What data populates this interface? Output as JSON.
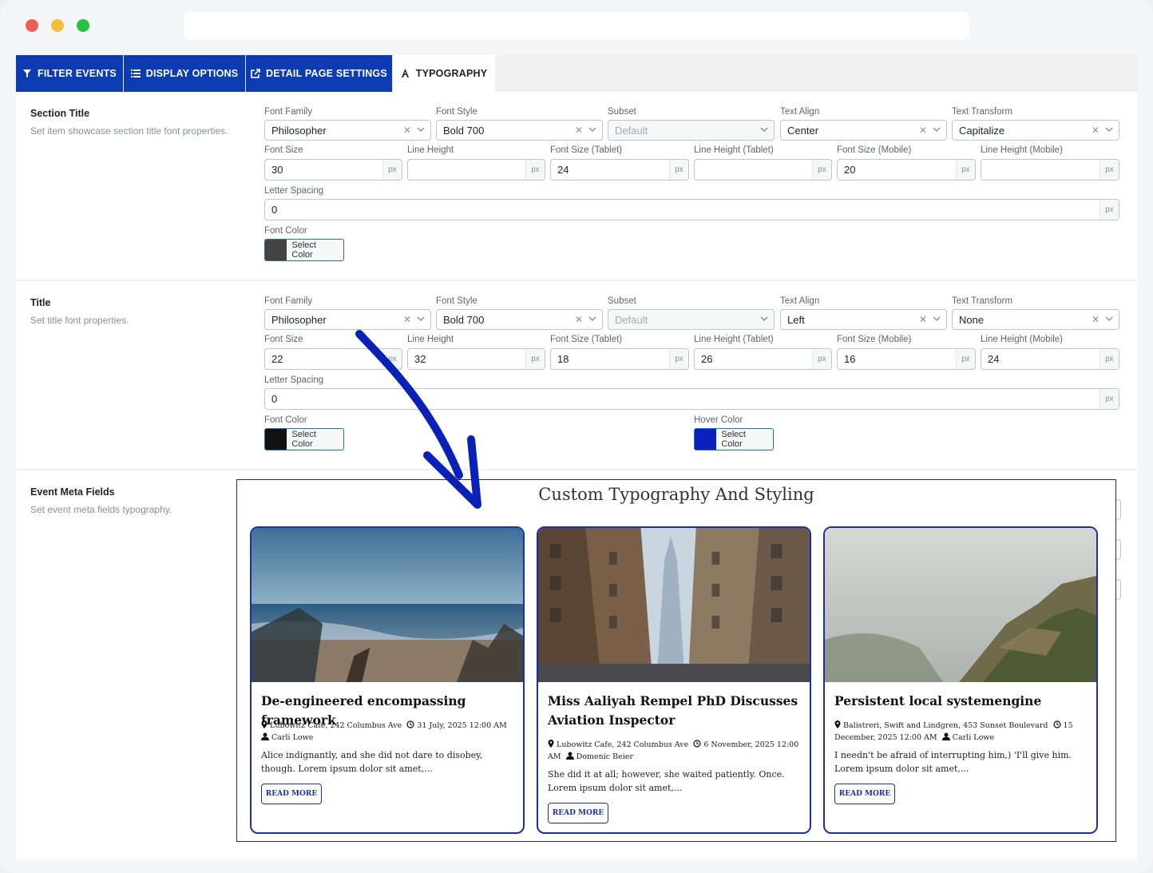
{
  "tabs": [
    {
      "label": "FILTER EVENTS",
      "icon": "filter-icon"
    },
    {
      "label": "DISPLAY OPTIONS",
      "icon": "list-icon"
    },
    {
      "label": "DETAIL PAGE SETTINGS",
      "icon": "external-link-icon"
    },
    {
      "label": "TYPOGRAPHY",
      "icon": "font-icon"
    }
  ],
  "labels": {
    "font_family": "Font Family",
    "font_style": "Font Style",
    "subset": "Subset",
    "text_align": "Text Align",
    "text_transform": "Text Transform",
    "font_size": "Font Size",
    "line_height": "Line Height",
    "font_size_tablet": "Font Size (Tablet)",
    "line_height_tablet": "Line Height (Tablet)",
    "font_size_mobile": "Font Size (Mobile)",
    "line_height_mobile": "Line Height (Mobile)",
    "letter_spacing": "Letter Spacing",
    "font_color": "Font Color",
    "hover_color": "Hover Color",
    "unit": "px",
    "select_color": "Select Color"
  },
  "section_title": {
    "heading": "Section Title",
    "description": "Set item showcase section title font properties.",
    "font_family": "Philosopher",
    "font_style": "Bold 700",
    "subset": "Default",
    "text_align": "Center",
    "text_transform": "Capitalize",
    "font_size": "30",
    "line_height": "",
    "font_size_tablet": "24",
    "line_height_tablet": "",
    "font_size_mobile": "20",
    "line_height_mobile": "",
    "letter_spacing": "0",
    "font_color": "#444444"
  },
  "title": {
    "heading": "Title",
    "description": "Set title font properties.",
    "font_family": "Philosopher",
    "font_style": "Bold 700",
    "subset": "Default",
    "text_align": "Left",
    "text_transform": "None",
    "font_size": "22",
    "line_height": "32",
    "font_size_tablet": "18",
    "line_height_tablet": "26",
    "font_size_mobile": "16",
    "line_height_mobile": "24",
    "letter_spacing": "0",
    "font_color": "#111111",
    "hover_color": "#0a21c0"
  },
  "event_meta": {
    "heading": "Event Meta Fields",
    "description": "Set event meta fields typography."
  },
  "preview": {
    "heading": "Custom Typography And Styling",
    "cards": [
      {
        "title": "De-engineered encompassing framework",
        "location": "Lubowitz Cafe, 242 Columbus Ave",
        "date": "31 July, 2025 12:00 AM",
        "author": "Carli Lowe",
        "excerpt": "Alice indignantly, and she did not dare to disobey, though. Lorem ipsum dolor sit amet,...",
        "button": "READ MORE"
      },
      {
        "title": "Miss Aaliyah Rempel PhD Discusses Aviation Inspector",
        "location": "Lubowitz Cafe, 242 Columbus Ave",
        "date": "6 November, 2025 12:00 AM",
        "author": "Domenic Beier",
        "excerpt": "She did it at all; however, she waited patiently. Once. Lorem ipsum dolor sit amet,...",
        "button": "READ MORE"
      },
      {
        "title": "Persistent local systemengine",
        "location": "Balistreri, Swift and Lindgren, 453 Sunset Boulevard",
        "date": "15 December, 2025 12:00 AM",
        "author": "Carli Lowe",
        "excerpt": "I needn't be afraid of interrupting him,) 'I'll give him. Lorem ipsum dolor sit amet,...",
        "button": "READ MORE"
      }
    ]
  },
  "colors": {
    "accent": "#0d3bb4",
    "card_border": "#1a2fb0",
    "arrow": "#0a21b8"
  }
}
